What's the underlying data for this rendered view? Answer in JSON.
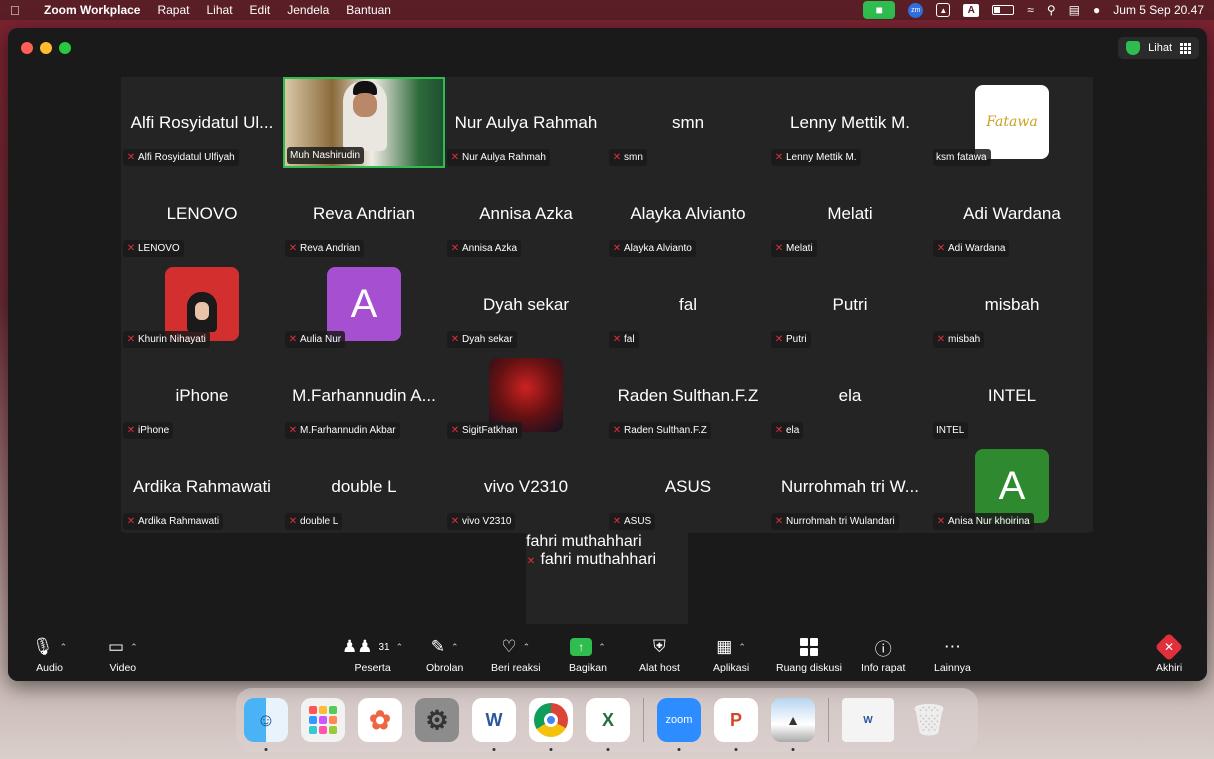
{
  "menubar": {
    "app_name": "Zoom Workplace",
    "menus": [
      "Rapat",
      "Lihat",
      "Edit",
      "Jendela",
      "Bantuan"
    ],
    "a_indicator": "A",
    "datetime": "Jum 5 Sep  20.47"
  },
  "window": {
    "view_label": "Lihat"
  },
  "participants": [
    {
      "big": "Alfi Rosyidatul Ul...",
      "label": "Alfi Rosyidatul Ulfiyah",
      "muted": true,
      "media": "none"
    },
    {
      "big": "",
      "label": "Muh Nashirudin",
      "muted": false,
      "media": "video"
    },
    {
      "big": "Nur Aulya Rahmah",
      "label": "Nur Aulya Rahmah",
      "muted": true,
      "media": "none"
    },
    {
      "big": "smn",
      "label": "smn",
      "muted": true,
      "media": "none"
    },
    {
      "big": "Lenny Mettik M.",
      "label": "Lenny Mettik M.",
      "muted": true,
      "media": "none"
    },
    {
      "big": "",
      "label": "ksm fatawa",
      "muted": false,
      "media": "logo",
      "avatar_text": "Fatawa"
    },
    {
      "big": "LENOVO",
      "label": "LENOVO",
      "muted": true,
      "media": "none"
    },
    {
      "big": "Reva Andrian",
      "label": "Reva Andrian",
      "muted": true,
      "media": "none"
    },
    {
      "big": "Annisa Azka",
      "label": "Annisa Azka",
      "muted": true,
      "media": "none"
    },
    {
      "big": "Alayka Alvianto",
      "label": "Alayka Alvianto",
      "muted": true,
      "media": "none"
    },
    {
      "big": "Melati",
      "label": "Melati",
      "muted": true,
      "media": "none"
    },
    {
      "big": "Adi Wardana",
      "label": "Adi Wardana",
      "muted": true,
      "media": "none"
    },
    {
      "big": "",
      "label": "Khurin Nihayati",
      "muted": true,
      "media": "photo-red"
    },
    {
      "big": "",
      "label": "Aulia Nur",
      "muted": true,
      "media": "letter-purple",
      "avatar_text": "A"
    },
    {
      "big": "Dyah sekar",
      "label": "Dyah sekar",
      "muted": true,
      "media": "none"
    },
    {
      "big": "fal",
      "label": "fal",
      "muted": true,
      "media": "none"
    },
    {
      "big": "Putri",
      "label": "Putri",
      "muted": true,
      "media": "none"
    },
    {
      "big": "misbah",
      "label": "misbah",
      "muted": true,
      "media": "none"
    },
    {
      "big": "iPhone",
      "label": "iPhone",
      "muted": true,
      "media": "none"
    },
    {
      "big": "M.Farhannudin A...",
      "label": "M.Farhannudin Akbar",
      "muted": true,
      "media": "none"
    },
    {
      "big": "",
      "label": "SigitFatkhan",
      "muted": true,
      "media": "photo-spider"
    },
    {
      "big": "Raden Sulthan.F.Z",
      "label": "Raden Sulthan.F.Z",
      "muted": true,
      "media": "none"
    },
    {
      "big": "ela",
      "label": "ela",
      "muted": true,
      "media": "none"
    },
    {
      "big": "INTEL",
      "label": "INTEL",
      "muted": false,
      "media": "none"
    },
    {
      "big": "Ardika Rahmawati",
      "label": "Ardika Rahmawati",
      "muted": true,
      "media": "none"
    },
    {
      "big": "double L",
      "label": "double L",
      "muted": true,
      "media": "none"
    },
    {
      "big": "vivo V2310",
      "label": "vivo V2310",
      "muted": true,
      "media": "none"
    },
    {
      "big": "ASUS",
      "label": "ASUS",
      "muted": true,
      "media": "none"
    },
    {
      "big": "Nurrohmah tri W...",
      "label": "Nurrohmah tri Wulandari",
      "muted": true,
      "media": "none"
    },
    {
      "big": "",
      "label": "Anisa Nur khoirina",
      "muted": true,
      "media": "letter-green",
      "avatar_text": "A"
    }
  ],
  "extra_participant": {
    "big": "fahri muthahhari",
    "label": "fahri muthahhari",
    "muted": true
  },
  "toolbar": {
    "audio": "Audio",
    "video": "Video",
    "participants": "Peserta",
    "participant_count": "31",
    "chat": "Obrolan",
    "reactions": "Beri reaksi",
    "share": "Bagikan",
    "host_tools": "Alat host",
    "apps": "Aplikasi",
    "breakout": "Ruang diskusi",
    "meeting_info": "Info rapat",
    "more": "Lainnya",
    "end": "Akhiri"
  },
  "dock": {
    "zoom_label": "zoom"
  },
  "colors": {
    "accent_green": "#2ebd4e",
    "muted_red": "#e0303c",
    "tile_bg": "#242424"
  }
}
